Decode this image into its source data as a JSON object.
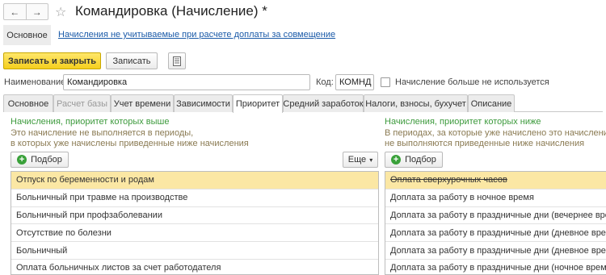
{
  "titlebar": {
    "back": "←",
    "forward": "→",
    "star": "☆",
    "title": "Командировка (Начисление) *"
  },
  "sections": {
    "main": "Основное",
    "link": "Начисления не учитываемые при расчете доплаты за совмещение"
  },
  "toolbar": {
    "save_close": "Записать и закрыть",
    "save": "Записать",
    "doc_icon": "document-icon"
  },
  "form": {
    "name_label": "Наименование:",
    "name_value": "Командировка",
    "code_label": "Код:",
    "code_value": "КОМНД",
    "unused_label": "Начисление больше не используется"
  },
  "tabs": [
    {
      "label": "Основное"
    },
    {
      "label": "Расчет базы"
    },
    {
      "label": "Учет времени"
    },
    {
      "label": "Зависимости"
    },
    {
      "label": "Приоритет"
    },
    {
      "label": "Средний заработок"
    },
    {
      "label": "Налоги, взносы, бухучет"
    },
    {
      "label": "Описание"
    }
  ],
  "left_panel": {
    "title": "Начисления, приоритет которых выше",
    "note1": "Это начисление не выполняется в периоды,",
    "note2": "в которых уже начислены приведенные ниже начисления",
    "pick": "Подбор",
    "more": "Еще",
    "rows": [
      "Отпуск по беременности и родам",
      "Больничный при травме на производстве",
      "Больничный при профзаболевании",
      "Отсутствие по болезни",
      "Больничный",
      "Оплата больничных листов за счет работодателя"
    ]
  },
  "right_panel": {
    "title": "Начисления, приоритет которых ниже",
    "note1": "В периодах, за которые уже начислено это начисление,",
    "note2": "не выполняются приведенные ниже начисления",
    "pick": "Подбор",
    "rows": [
      "Оплата сверхурочных часов",
      "Доплата за работу в ночное время",
      "Доплата за работу в праздничные дни (вечернее время)",
      "Доплата за работу в праздничные дни (дневное время)",
      "Доплата за работу в праздничные дни (дневное время)",
      "Доплата за работу в праздничные дни (ночное время)"
    ]
  },
  "colors": {
    "accent_yellow": "#f5cf1e",
    "selected_row": "#fbe7a4",
    "link": "#1a5aa8",
    "green_title": "#3c9a3c"
  }
}
